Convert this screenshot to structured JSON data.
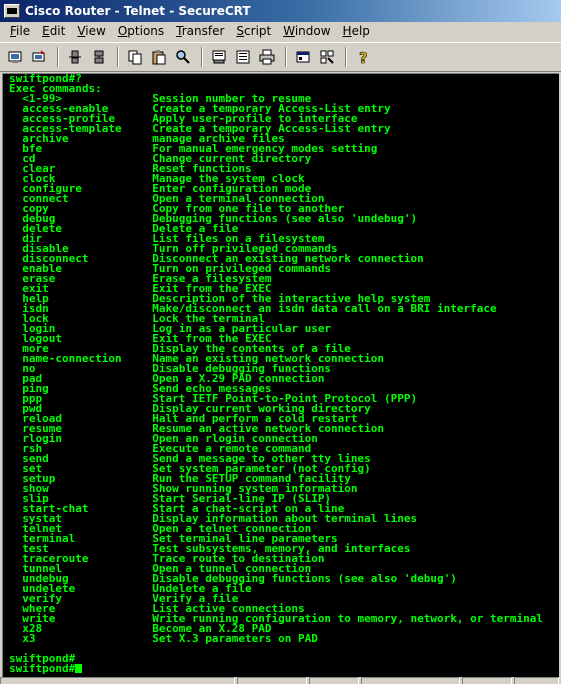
{
  "window": {
    "title": "Cisco Router - Telnet - SecureCRT"
  },
  "menu": [
    {
      "pre": "",
      "key": "F",
      "post": "ile"
    },
    {
      "pre": "",
      "key": "E",
      "post": "dit"
    },
    {
      "pre": "",
      "key": "V",
      "post": "iew"
    },
    {
      "pre": "",
      "key": "O",
      "post": "ptions"
    },
    {
      "pre": "",
      "key": "T",
      "post": "ransfer"
    },
    {
      "pre": "",
      "key": "S",
      "post": "cript"
    },
    {
      "pre": "",
      "key": "W",
      "post": "indow"
    },
    {
      "pre": "",
      "key": "H",
      "post": "elp"
    }
  ],
  "toolbar": {
    "icons": [
      "connect-icon",
      "quick-connect-icon",
      "disconnect-icon",
      "reconnect-icon",
      "copy-icon",
      "paste-icon",
      "find-icon",
      "print-setup-icon",
      "log-session-icon",
      "print-icon",
      "session-options-icon",
      "global-options-icon",
      "help-icon"
    ]
  },
  "terminal": {
    "header_lines": [
      "swiftpond#?",
      "Exec commands:"
    ],
    "commands": [
      {
        "name": "<1-99>",
        "desc": "Session number to resume"
      },
      {
        "name": "access-enable",
        "desc": "Create a temporary Access-List entry"
      },
      {
        "name": "access-profile",
        "desc": "Apply user-profile to interface"
      },
      {
        "name": "access-template",
        "desc": "Create a temporary Access-List entry"
      },
      {
        "name": "archive",
        "desc": "manage archive files"
      },
      {
        "name": "bfe",
        "desc": "For manual emergency modes setting"
      },
      {
        "name": "cd",
        "desc": "Change current directory"
      },
      {
        "name": "clear",
        "desc": "Reset functions"
      },
      {
        "name": "clock",
        "desc": "Manage the system clock"
      },
      {
        "name": "configure",
        "desc": "Enter configuration mode"
      },
      {
        "name": "connect",
        "desc": "Open a terminal connection"
      },
      {
        "name": "copy",
        "desc": "Copy from one file to another"
      },
      {
        "name": "debug",
        "desc": "Debugging functions (see also 'undebug')"
      },
      {
        "name": "delete",
        "desc": "Delete a file"
      },
      {
        "name": "dir",
        "desc": "List files on a filesystem"
      },
      {
        "name": "disable",
        "desc": "Turn off privileged commands"
      },
      {
        "name": "disconnect",
        "desc": "Disconnect an existing network connection"
      },
      {
        "name": "enable",
        "desc": "Turn on privileged commands"
      },
      {
        "name": "erase",
        "desc": "Erase a filesystem"
      },
      {
        "name": "exit",
        "desc": "Exit from the EXEC"
      },
      {
        "name": "help",
        "desc": "Description of the interactive help system"
      },
      {
        "name": "isdn",
        "desc": "Make/disconnect an isdn data call on a BRI interface"
      },
      {
        "name": "lock",
        "desc": "Lock the terminal"
      },
      {
        "name": "login",
        "desc": "Log in as a particular user"
      },
      {
        "name": "logout",
        "desc": "Exit from the EXEC"
      },
      {
        "name": "more",
        "desc": "Display the contents of a file"
      },
      {
        "name": "name-connection",
        "desc": "Name an existing network connection"
      },
      {
        "name": "no",
        "desc": "Disable debugging functions"
      },
      {
        "name": "pad",
        "desc": "Open a X.29 PAD connection"
      },
      {
        "name": "ping",
        "desc": "Send echo messages"
      },
      {
        "name": "ppp",
        "desc": "Start IETF Point-to-Point Protocol (PPP)"
      },
      {
        "name": "pwd",
        "desc": "Display current working directory"
      },
      {
        "name": "reload",
        "desc": "Halt and perform a cold restart"
      },
      {
        "name": "resume",
        "desc": "Resume an active network connection"
      },
      {
        "name": "rlogin",
        "desc": "Open an rlogin connection"
      },
      {
        "name": "rsh",
        "desc": "Execute a remote command"
      },
      {
        "name": "send",
        "desc": "Send a message to other tty lines"
      },
      {
        "name": "set",
        "desc": "Set system parameter (not config)"
      },
      {
        "name": "setup",
        "desc": "Run the SETUP command facility"
      },
      {
        "name": "show",
        "desc": "Show running system information"
      },
      {
        "name": "slip",
        "desc": "Start Serial-line IP (SLIP)"
      },
      {
        "name": "start-chat",
        "desc": "Start a chat-script on a line"
      },
      {
        "name": "systat",
        "desc": "Display information about terminal lines"
      },
      {
        "name": "telnet",
        "desc": "Open a telnet connection"
      },
      {
        "name": "terminal",
        "desc": "Set terminal line parameters"
      },
      {
        "name": "test",
        "desc": "Test subsystems, memory, and interfaces"
      },
      {
        "name": "traceroute",
        "desc": "Trace route to destination"
      },
      {
        "name": "tunnel",
        "desc": "Open a tunnel connection"
      },
      {
        "name": "undebug",
        "desc": "Disable debugging functions (see also 'debug')"
      },
      {
        "name": "undelete",
        "desc": "Undelete a file"
      },
      {
        "name": "verify",
        "desc": "Verify a file"
      },
      {
        "name": "where",
        "desc": "List active connections"
      },
      {
        "name": "write",
        "desc": "Write running configuration to memory, network, or terminal"
      },
      {
        "name": "x28",
        "desc": "Become an X.28 PAD"
      },
      {
        "name": "x3",
        "desc": "Set X.3 parameters on PAD"
      }
    ],
    "footer_lines": [
      "swiftpond#",
      "swiftpond#"
    ],
    "colors": {
      "foreground": "#00ff00",
      "background": "#000000"
    }
  }
}
